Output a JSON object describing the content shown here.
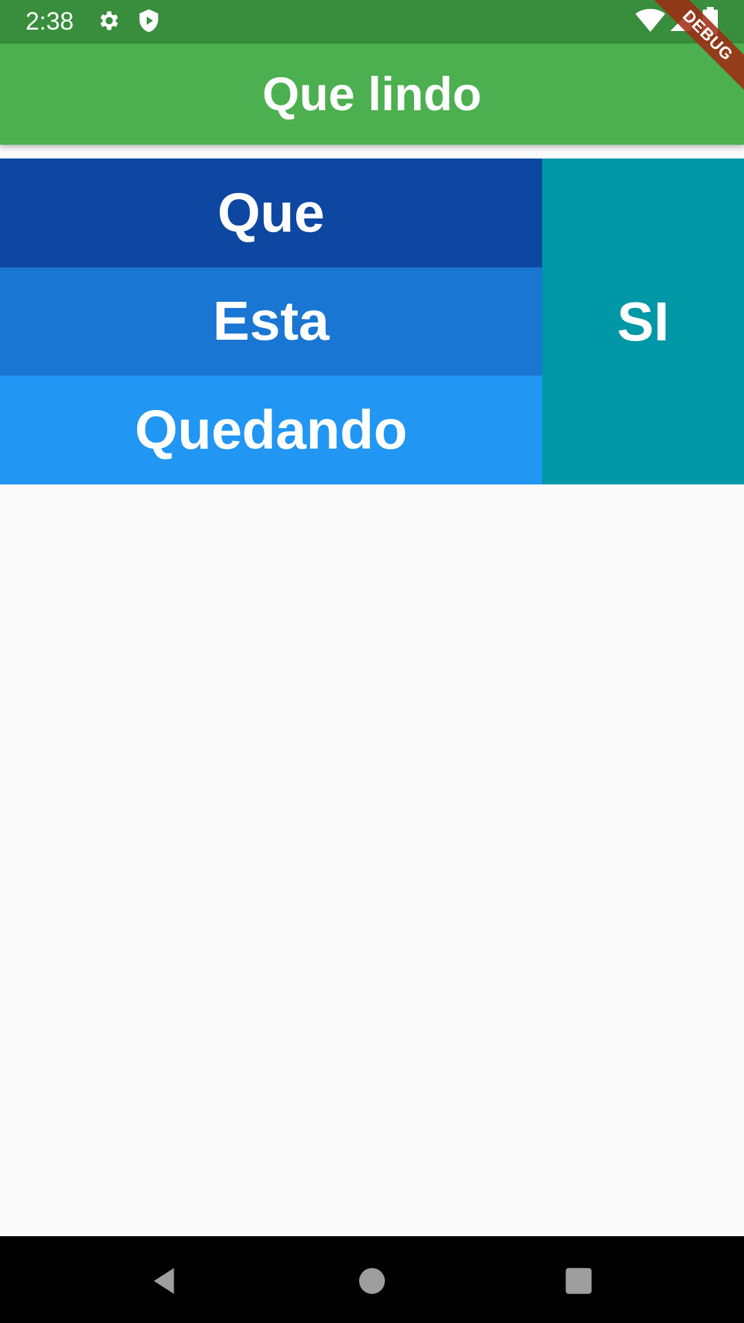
{
  "status_bar": {
    "time": "2:38",
    "background": "#388e3c",
    "icons": [
      "settings-icon",
      "shield-play-icon",
      "wifi-icon",
      "signal-icon",
      "battery-icon"
    ]
  },
  "app_bar": {
    "title": "Que lindo",
    "background": "#4caf50"
  },
  "debug_banner": {
    "label": "DEBUG"
  },
  "grid": {
    "left_column": [
      {
        "label": "Que",
        "color": "#0d47a1"
      },
      {
        "label": "Esta",
        "color": "#1976d2"
      },
      {
        "label": "Quedando",
        "color": "#2196f3"
      }
    ],
    "right_column": {
      "label": "SI",
      "color": "#0097a7"
    }
  },
  "nav_bar": {
    "buttons": [
      "back-icon",
      "home-icon",
      "recents-icon"
    ]
  }
}
